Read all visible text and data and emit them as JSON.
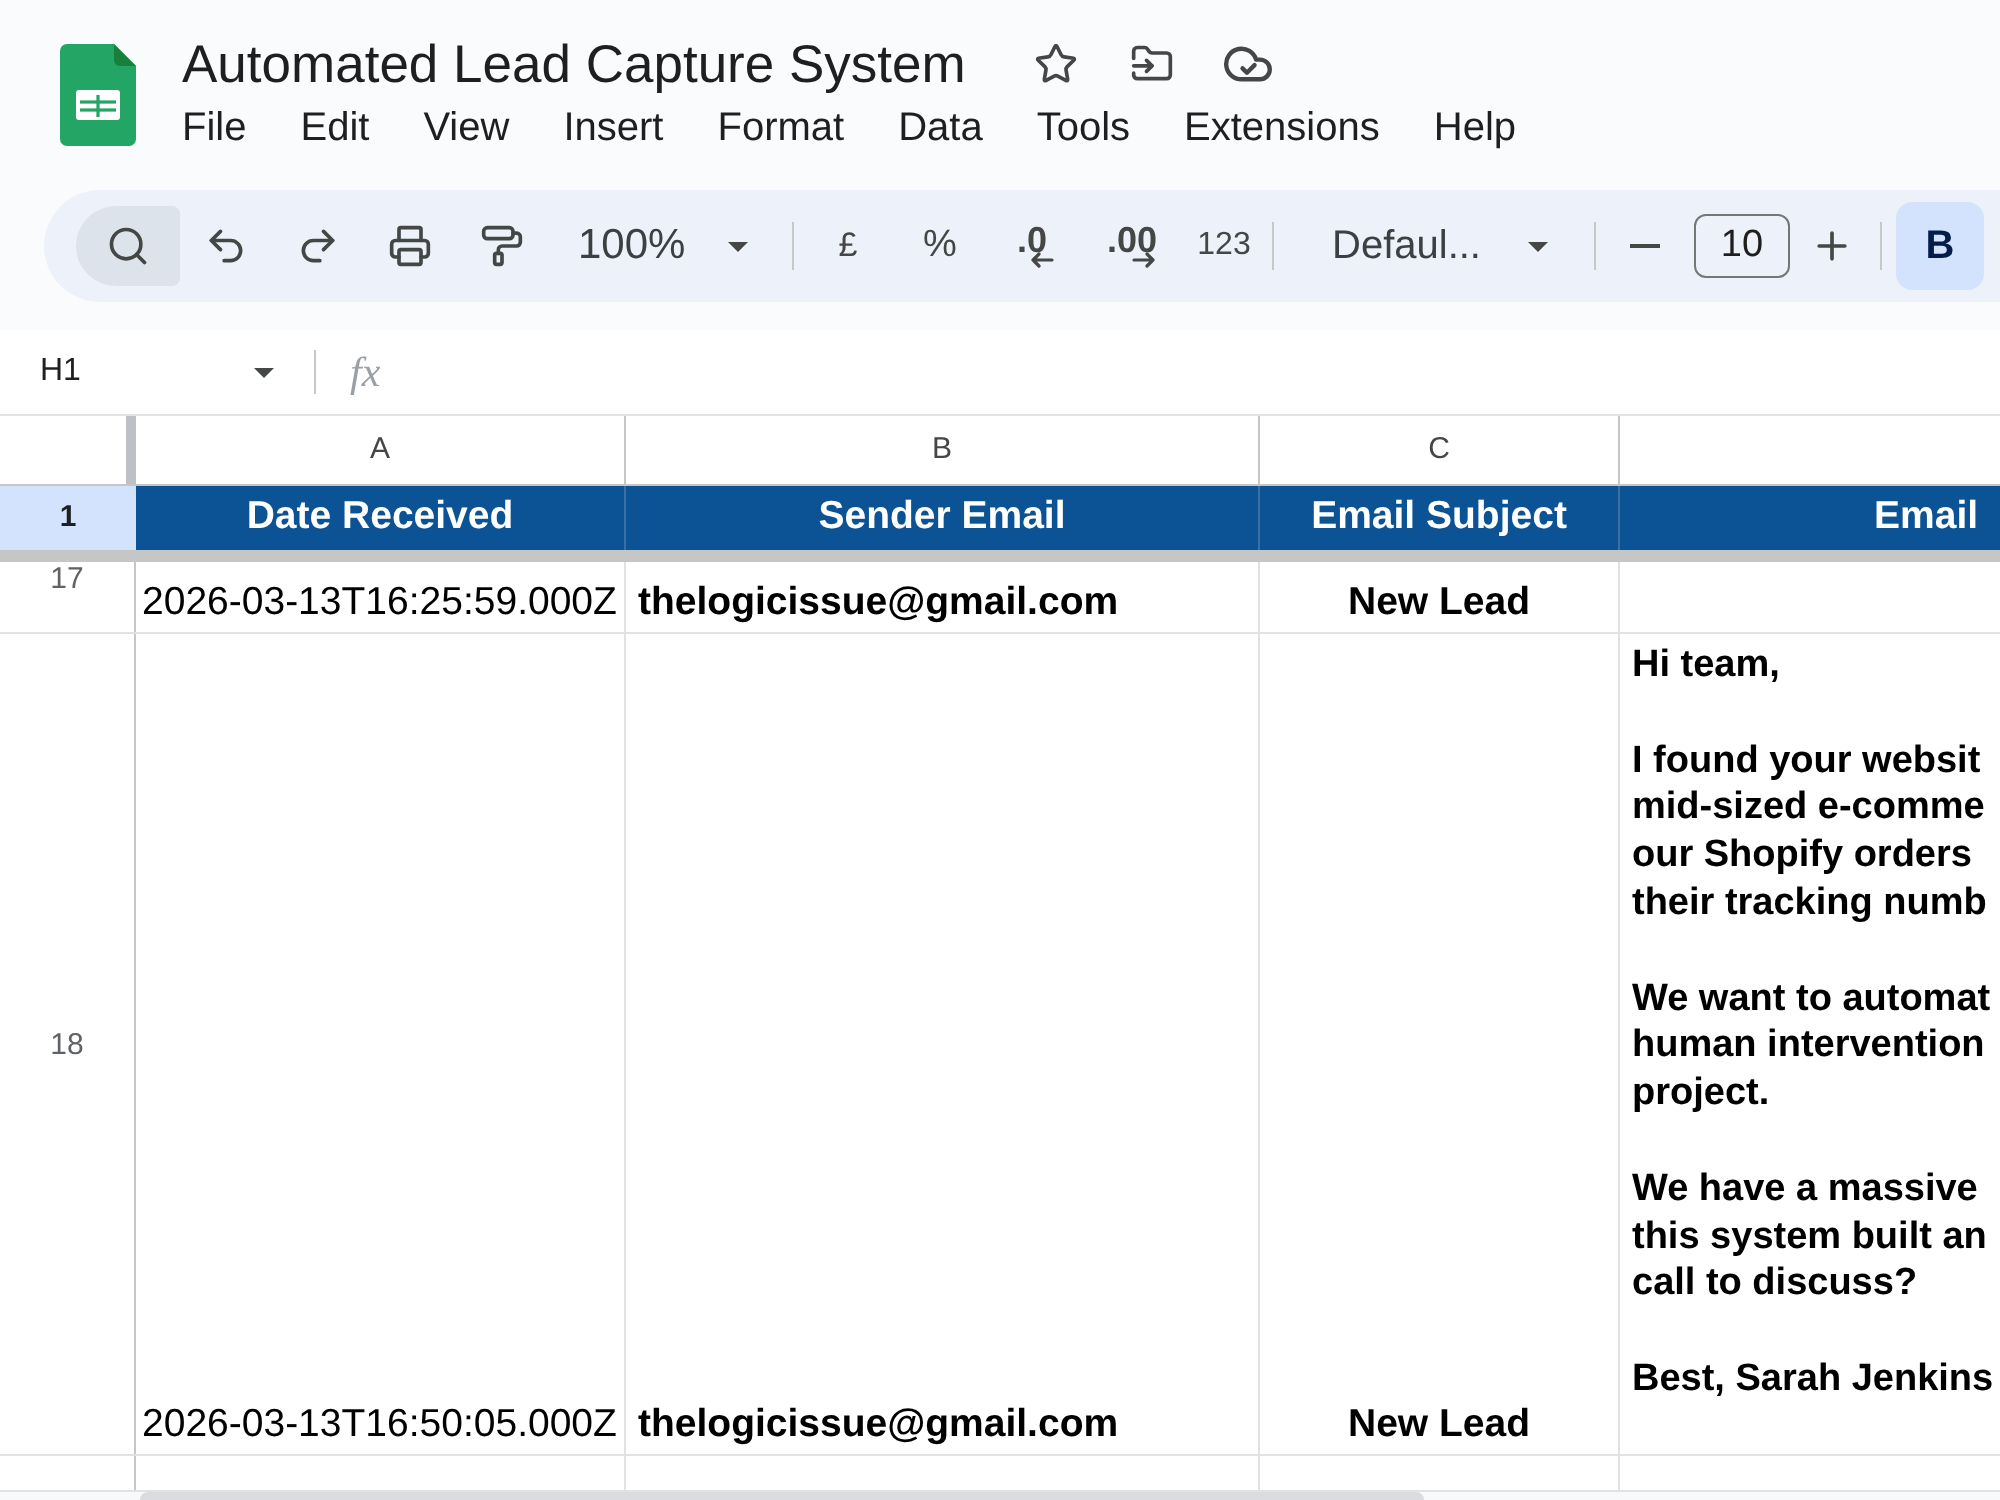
{
  "app": {
    "title": "Automated Lead Capture System"
  },
  "menu": [
    "File",
    "Edit",
    "View",
    "Insert",
    "Format",
    "Data",
    "Tools",
    "Extensions",
    "Help"
  ],
  "toolbar": {
    "groups": [
      [
        {
          "kind": "search"
        },
        {
          "kind": "undo"
        },
        {
          "kind": "redo"
        },
        {
          "kind": "print"
        },
        {
          "kind": "paint-format"
        },
        {
          "kind": "zoom",
          "label": "100%"
        }
      ],
      [
        {
          "kind": "currency",
          "label": "£"
        },
        {
          "kind": "percent",
          "label": "%"
        },
        {
          "kind": "decimal-down",
          "label": ".0"
        },
        {
          "kind": "decimal-up",
          "label": ".00"
        },
        {
          "kind": "number-format",
          "label": "123"
        }
      ],
      [
        {
          "kind": "font",
          "label": "Defaul..."
        }
      ],
      [
        {
          "kind": "minus"
        },
        {
          "kind": "size",
          "value": "10"
        },
        {
          "kind": "plus"
        }
      ],
      [
        {
          "kind": "bold",
          "label": "B",
          "on": true
        }
      ]
    ]
  },
  "formula_bar": {
    "cell": "H1",
    "function_label": "fx"
  },
  "sheet": {
    "column_letters": [
      "A",
      "B",
      "C"
    ],
    "header_row": {
      "number": "1",
      "selected": true,
      "cells": [
        "Date Received",
        "Sender Email",
        "Email Subject",
        "Email"
      ]
    },
    "rows": [
      {
        "number": "17",
        "selected": false,
        "cells": [
          "2026-03-13T16:25:59.000Z",
          "thelogicissue@gmail.com",
          "New Lead"
        ]
      },
      {
        "number": "18",
        "selected": false,
        "cells": [
          "2026-03-13T16:50:05.000Z",
          "thelogicissue@gmail.com",
          "New Lead"
        ],
        "message": [
          [
            "Hi team,"
          ],
          [
            "I found your websit",
            "mid-sized e-comme",
            "our Shopify orders",
            "their tracking numb"
          ],
          [
            "We want to automat",
            "human intervention",
            "project."
          ],
          [
            "We have a massive",
            "this system built an",
            "call to discuss?"
          ],
          [
            "Best, Sarah Jenkins"
          ]
        ]
      },
      {
        "selected": false
      }
    ]
  }
}
